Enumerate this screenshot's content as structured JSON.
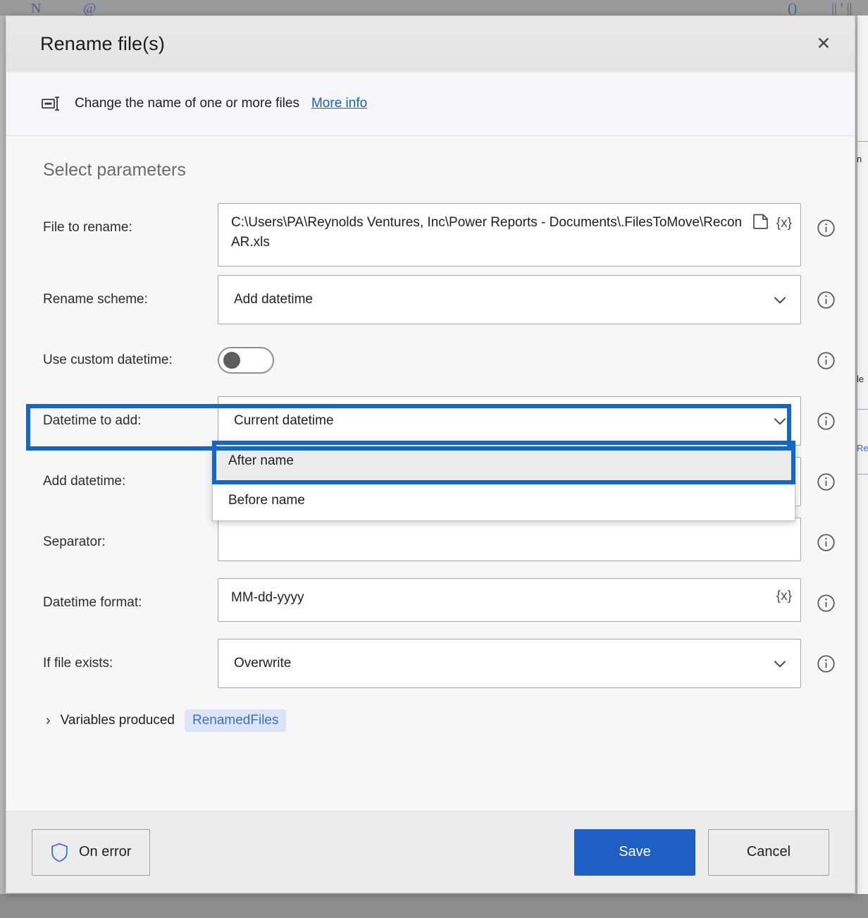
{
  "background": {
    "glyphs": [
      "N",
      "@",
      "()",
      "|| ' ||"
    ],
    "side_labels": [
      "n",
      "le",
      "Re"
    ]
  },
  "dialog": {
    "title": "Rename file(s)",
    "close_label": "✕",
    "subbar": {
      "icon": "rename-tag-icon",
      "text": "Change the name of one or more files",
      "link": "More info"
    },
    "section_title": "Select parameters",
    "rows": [
      {
        "label": "File to rename:",
        "type": "text",
        "value": "C:\\Users\\PA\\Reynolds Ventures, Inc\\Power Reports - Documents\\.FilesToMove\\ReconAR.xls",
        "adornments": [
          "file-picker-icon",
          "{x}"
        ]
      },
      {
        "label": "Rename scheme:",
        "type": "select",
        "value": "Add datetime"
      },
      {
        "label": "Use custom datetime:",
        "type": "toggle",
        "value": "off"
      },
      {
        "label": "Datetime to add:",
        "type": "select",
        "value": "Current datetime"
      },
      {
        "label": "Add datetime:",
        "type": "select-open",
        "value": "After name",
        "options": [
          "After name",
          "Before name"
        ],
        "selected_option": "After name",
        "highlighted": true
      },
      {
        "label": "Separator:",
        "type": "text",
        "value": ""
      },
      {
        "label": "Datetime format:",
        "type": "text",
        "value": "MM-dd-yyyy",
        "adornments": [
          "{x}"
        ]
      },
      {
        "label": "If file exists:",
        "type": "select",
        "value": "Overwrite"
      }
    ],
    "variables": {
      "chevron": "›",
      "label": "Variables produced",
      "badge": "RenamedFiles"
    },
    "footer": {
      "on_error_label": "On error",
      "save_label": "Save",
      "cancel_label": "Cancel"
    }
  },
  "colors": {
    "accent_blue": "#1f5fc4",
    "annotation_blue": "#1267c8",
    "link_blue": "#1a5fb4",
    "badge_blue": "#3b6fd4"
  }
}
